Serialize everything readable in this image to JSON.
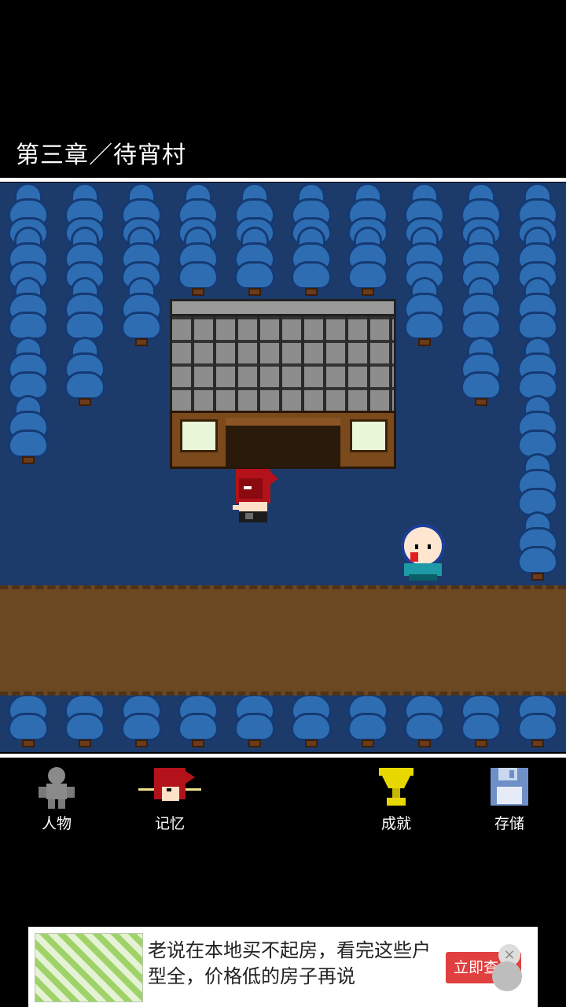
{
  "scene": {
    "chapter_title": "第三章／待宵村"
  },
  "hud": {
    "items": [
      {
        "label": "人物",
        "icon": "person-icon"
      },
      {
        "label": "记忆",
        "icon": "memory-icon"
      },
      {
        "label": "成就",
        "icon": "trophy-icon"
      },
      {
        "label": "存储",
        "icon": "save-disk-icon"
      }
    ]
  },
  "ad": {
    "text": "老说在本地买不起房，看完这些户型全，价格低的房子再说",
    "button_label": "立即查看",
    "close_glyph": "×"
  },
  "colors": {
    "ground": "#1c3a6a",
    "tree": "#2f6db3",
    "path": "#6b4722",
    "trophy": "#e8d800",
    "ad_button": "#e04040"
  }
}
